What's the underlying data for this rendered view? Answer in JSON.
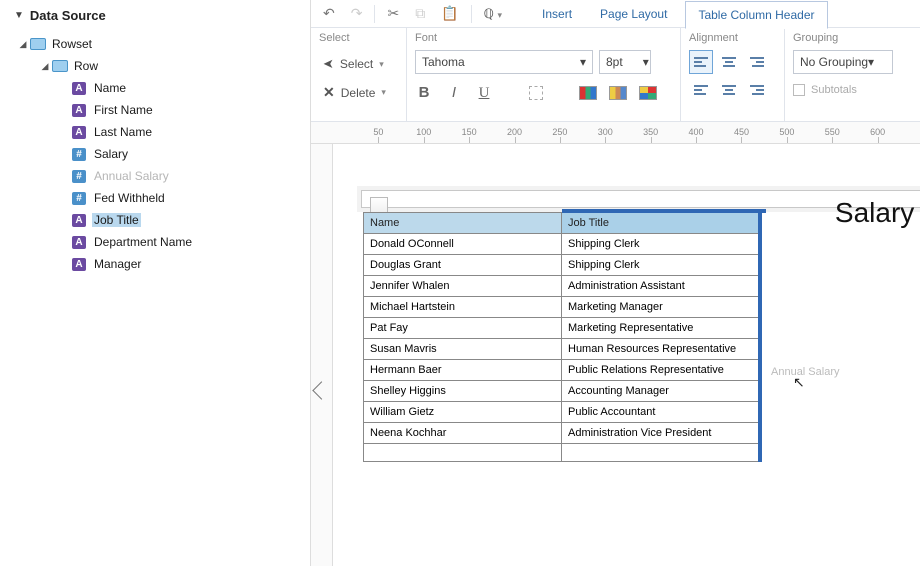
{
  "sidebar": {
    "title": "Data Source",
    "rowset": "Rowset",
    "row": "Row",
    "fields": [
      {
        "label": "Name",
        "type": "A",
        "ghost": false,
        "sel": false
      },
      {
        "label": "First Name",
        "type": "A",
        "ghost": false,
        "sel": false
      },
      {
        "label": "Last Name",
        "type": "A",
        "ghost": false,
        "sel": false
      },
      {
        "label": "Salary",
        "type": "N",
        "ghost": false,
        "sel": false
      },
      {
        "label": "Annual Salary",
        "type": "N",
        "ghost": true,
        "sel": false
      },
      {
        "label": "Fed Withheld",
        "type": "N",
        "ghost": false,
        "sel": false
      },
      {
        "label": "Job Title",
        "type": "A",
        "ghost": false,
        "sel": true
      },
      {
        "label": "Department Name",
        "type": "A",
        "ghost": false,
        "sel": false
      },
      {
        "label": "Manager",
        "type": "A",
        "ghost": false,
        "sel": false
      }
    ]
  },
  "toolbar": {
    "insert": "Insert",
    "page_layout": "Page Layout",
    "active_tab": "Table Column Header"
  },
  "ribbon": {
    "select_group": "Select",
    "select": "Select",
    "delete": "Delete",
    "font_group": "Font",
    "font": "Tahoma",
    "size": "8pt",
    "align_group": "Alignment",
    "grouping_group": "Grouping",
    "grouping_value": "No Grouping",
    "subtotals": "Subtotals"
  },
  "ruler": {
    "ticks": [
      50,
      100,
      150,
      200,
      250,
      300,
      350,
      400,
      450,
      500,
      550,
      600
    ]
  },
  "page": {
    "title": "Salary Repo",
    "drag_label": "Annual Salary"
  },
  "table": {
    "headers": [
      "Name",
      "Job Title"
    ],
    "rows": [
      [
        "Donald OConnell",
        "Shipping Clerk"
      ],
      [
        "Douglas Grant",
        "Shipping Clerk"
      ],
      [
        "Jennifer Whalen",
        "Administration Assistant"
      ],
      [
        "Michael Hartstein",
        "Marketing Manager"
      ],
      [
        "Pat Fay",
        "Marketing Representative"
      ],
      [
        "Susan Mavris",
        "Human Resources Representative"
      ],
      [
        "Hermann Baer",
        "Public Relations Representative"
      ],
      [
        "Shelley Higgins",
        "Accounting Manager"
      ],
      [
        "William Gietz",
        "Public Accountant"
      ],
      [
        "Neena Kochhar",
        "Administration Vice President"
      ]
    ]
  }
}
